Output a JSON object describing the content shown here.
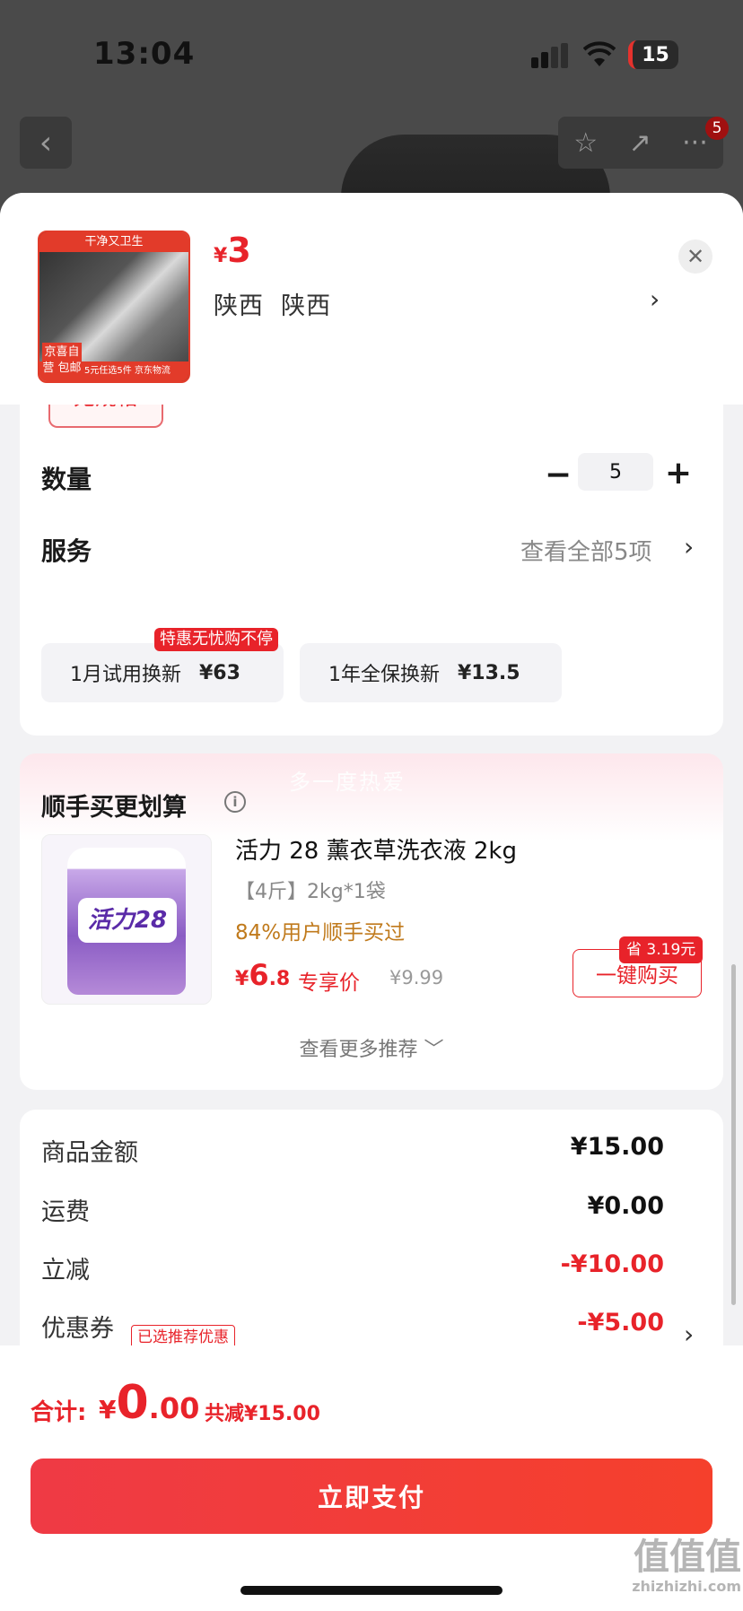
{
  "status_bar": {
    "time": "13:04",
    "battery": "15"
  },
  "nav": {
    "badge_count": "5"
  },
  "product": {
    "price_currency": "¥",
    "price": "3",
    "region": "陕西  陕西",
    "thumb_top_text": "干净又卫生",
    "thumb_left_text": "京喜自营 包邮",
    "thumb_bottom_text": "5元任选5件 京东物流"
  },
  "spec": {
    "label": "无规格"
  },
  "quantity": {
    "label": "数量",
    "value": "5"
  },
  "service": {
    "label": "服务",
    "view_all": "查看全部5项",
    "options": [
      {
        "name": "1月试用换新",
        "price": "¥63",
        "tag": "特惠无忧购不停"
      },
      {
        "name": "1年全保换新",
        "price": "¥13.5"
      }
    ]
  },
  "addon": {
    "watermark": "多一度热爱",
    "title": "顺手买更划算",
    "item": {
      "image_label": "活力28",
      "name": "活力 28 薰衣草洗衣液 2kg",
      "spec": "【4斤】2kg*1袋",
      "bought_pct": "84%用户顺手买过",
      "price_currency": "¥",
      "price_int": "6",
      "price_dec": ".8",
      "exclusive": "专享价",
      "original": "¥9.99",
      "save": "省 3.19元",
      "buy_label": "一键购买"
    },
    "more": "查看更多推荐 ﹀"
  },
  "summary": {
    "rows": [
      {
        "label": "商品金额",
        "value": "¥15.00"
      },
      {
        "label": "运费",
        "value": "¥0.00"
      },
      {
        "label": "立减",
        "value": "-¥10.00"
      },
      {
        "label": "优惠券",
        "value": "-¥5.00",
        "tag": "已选推荐优惠"
      }
    ]
  },
  "footer": {
    "total_label": "合计:",
    "total_currency": "¥",
    "total_int": "0",
    "total_dec": ".00",
    "total_reduction": "共减¥15.00",
    "pay_label": "立即支付"
  },
  "watermark_logo": {
    "main": "值值值",
    "sub": "zhizhizhi.com"
  },
  "colors": {
    "accent": "#e8232a",
    "orange": "#c07a1c",
    "sheet_bg": "#f2f2f4"
  }
}
